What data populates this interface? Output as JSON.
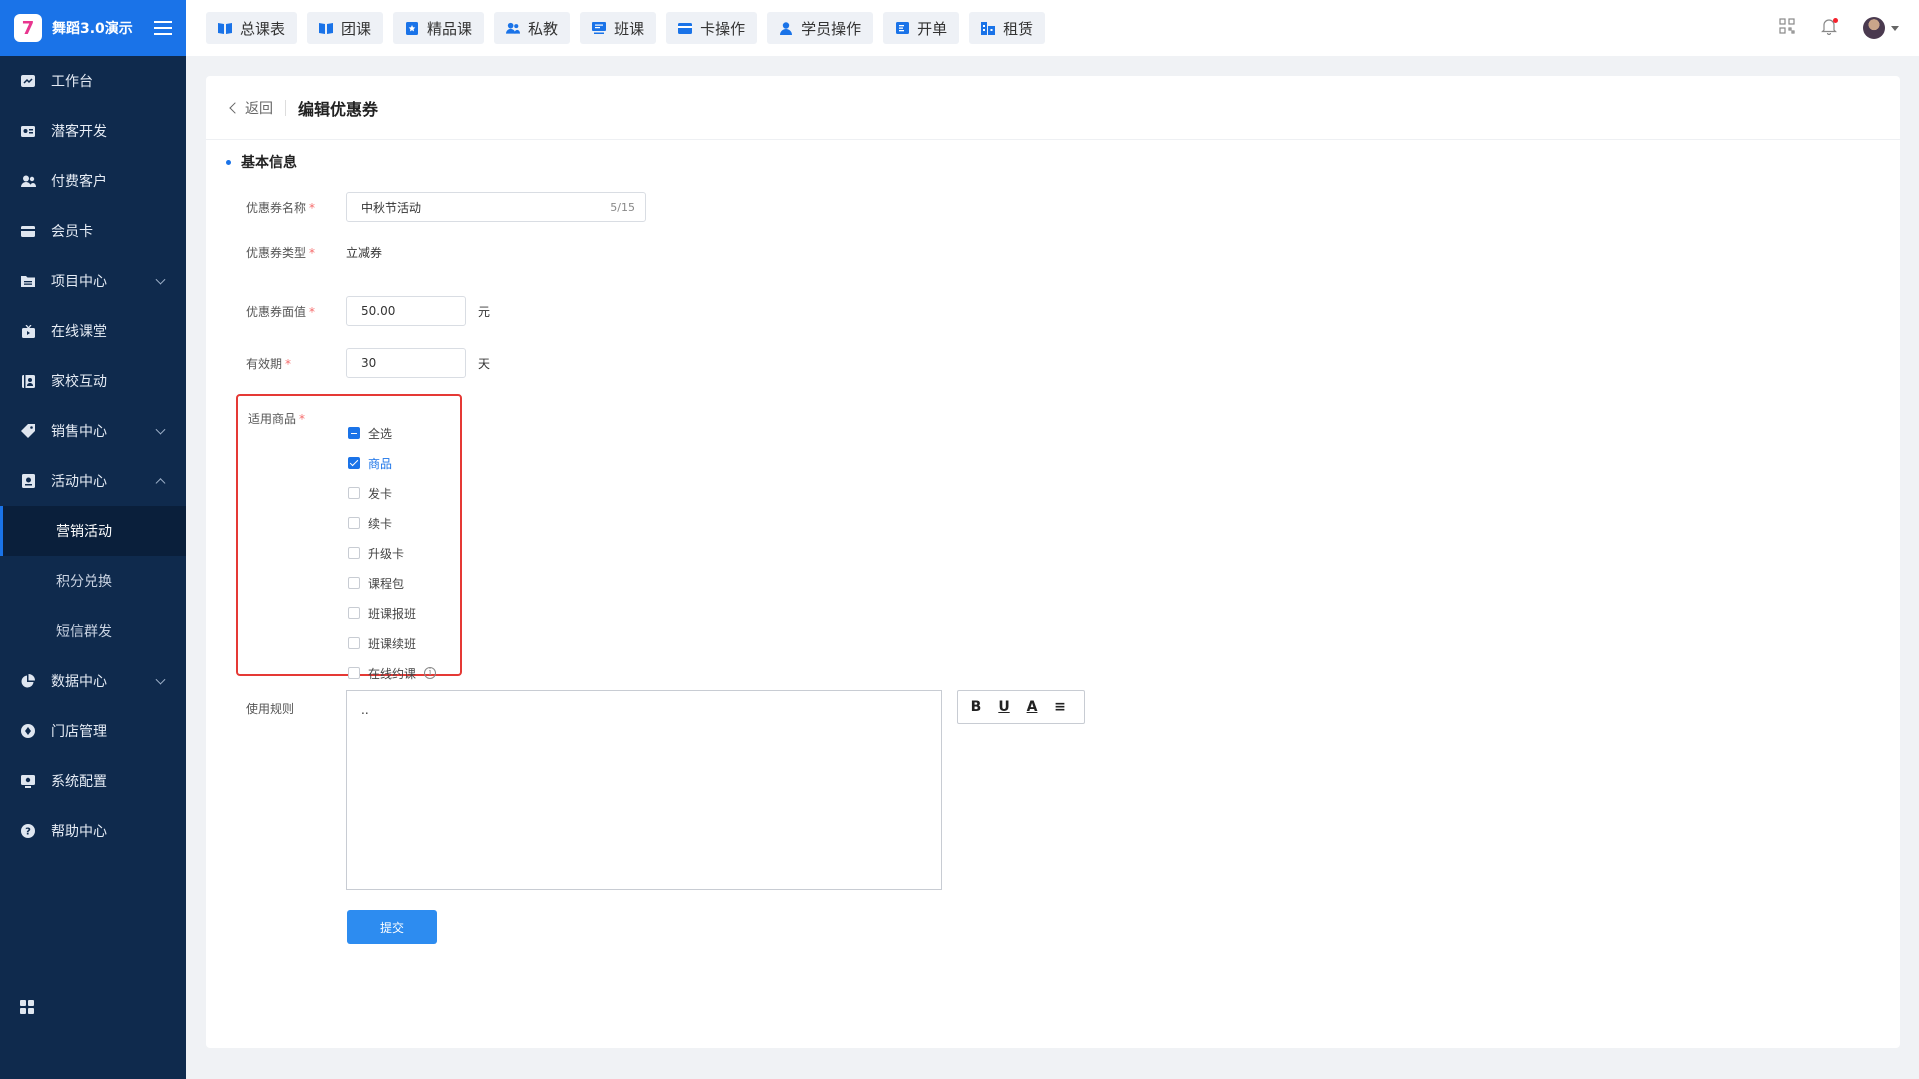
{
  "brand": {
    "name": "舞蹈3.0演示",
    "logo_char": "7"
  },
  "sidebar": {
    "items": [
      {
        "label": "工作台",
        "icon": "dashboard-icon"
      },
      {
        "label": "潜客开发",
        "icon": "id-card-icon"
      },
      {
        "label": "付费客户",
        "icon": "users-icon"
      },
      {
        "label": "会员卡",
        "icon": "card-icon"
      },
      {
        "label": "项目中心",
        "icon": "folder-icon",
        "expandable": true
      },
      {
        "label": "在线课堂",
        "icon": "tv-icon"
      },
      {
        "label": "家校互动",
        "icon": "contacts-icon"
      },
      {
        "label": "销售中心",
        "icon": "tag-icon",
        "expandable": true
      },
      {
        "label": "活动中心",
        "icon": "activity-icon",
        "expanded": true
      }
    ],
    "sub_items": [
      {
        "label": "营销活动",
        "active": true
      },
      {
        "label": "积分兑换"
      },
      {
        "label": "短信群发"
      }
    ],
    "items_after": [
      {
        "label": "数据中心",
        "icon": "pie-chart-icon",
        "expandable": true
      },
      {
        "label": "门店管理",
        "icon": "store-icon"
      },
      {
        "label": "系统配置",
        "icon": "settings-icon"
      },
      {
        "label": "帮助中心",
        "icon": "help-icon"
      }
    ]
  },
  "topbar": {
    "quick_buttons": [
      {
        "label": "总课表",
        "icon": "book-icon"
      },
      {
        "label": "团课",
        "icon": "book-icon"
      },
      {
        "label": "精品课",
        "icon": "star-book-icon"
      },
      {
        "label": "私教",
        "icon": "users-icon"
      },
      {
        "label": "班课",
        "icon": "board-icon"
      },
      {
        "label": "卡操作",
        "icon": "wallet-icon"
      },
      {
        "label": "学员操作",
        "icon": "user-icon"
      },
      {
        "label": "开单",
        "icon": "receipt-icon"
      },
      {
        "label": "租赁",
        "icon": "building-icon"
      }
    ]
  },
  "page": {
    "back_label": "返回",
    "title": "编辑优惠券",
    "section_title": "基本信息"
  },
  "form": {
    "name": {
      "label": "优惠券名称",
      "value": "中秋节活动",
      "count": "5/15"
    },
    "type": {
      "label": "优惠券类型",
      "value": "立减券"
    },
    "amount": {
      "label": "优惠券面值",
      "value": "50.00",
      "unit": "元"
    },
    "validity": {
      "label": "有效期",
      "value": "30",
      "unit": "天"
    },
    "required_mark": "*",
    "goods": {
      "label": "适用商品",
      "options": [
        {
          "label": "全选",
          "state": "indeterminate"
        },
        {
          "label": "商品",
          "state": "checked"
        },
        {
          "label": "发卡",
          "state": "unchecked"
        },
        {
          "label": "续卡",
          "state": "unchecked"
        },
        {
          "label": "升级卡",
          "state": "unchecked"
        },
        {
          "label": "课程包",
          "state": "unchecked"
        },
        {
          "label": "班课报班",
          "state": "unchecked"
        },
        {
          "label": "班课续班",
          "state": "unchecked"
        },
        {
          "label": "在线约课",
          "state": "unchecked",
          "info": "i"
        }
      ]
    },
    "rules": {
      "label": "使用规则",
      "value": ".."
    },
    "editor_toolbar": [
      "B",
      "U",
      "A",
      "≡"
    ],
    "submit_label": "提交"
  },
  "colors": {
    "primary": "#1a73e8",
    "sidebar_bg": "#0f2a4d",
    "highlight_border": "#e53935"
  }
}
